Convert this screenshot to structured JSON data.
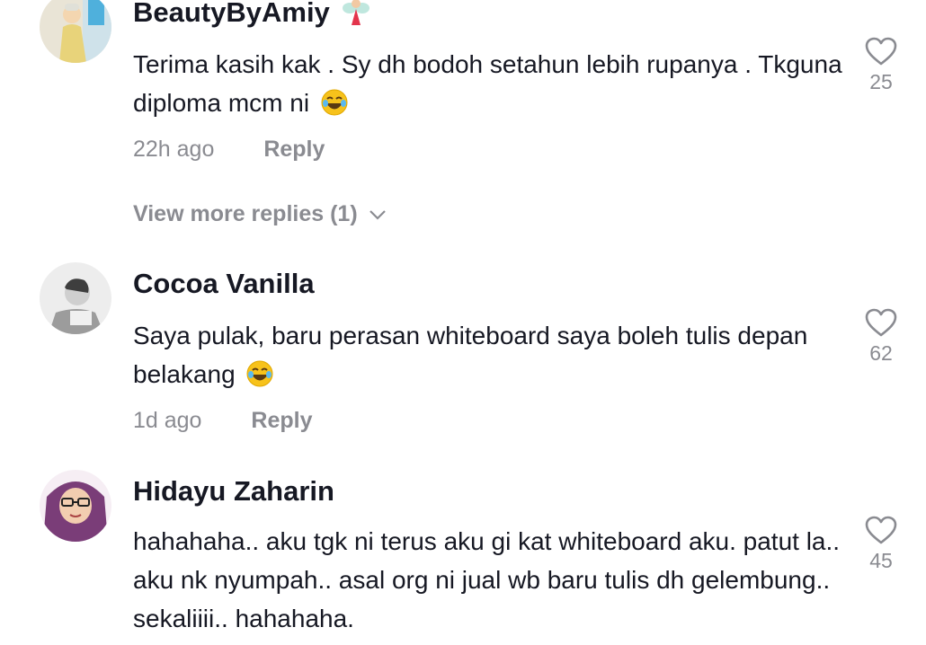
{
  "comments": [
    {
      "username": "BeautyByAmiy",
      "badge_icon": "fairy-emoji-icon",
      "text": "Terima kasih kak . Sy dh bodoh setahun lebih rupanya . Tkguna diploma mcm ni",
      "emoji": "laughing-emoji-icon",
      "time": "22h ago",
      "reply_label": "Reply",
      "likes": "25",
      "view_more": "View more replies (1)"
    },
    {
      "username": "Cocoa Vanilla",
      "text": "Saya pulak, baru perasan whiteboard saya boleh tulis depan belakang",
      "emoji": "laughing-emoji-icon",
      "time": "1d ago",
      "reply_label": "Reply",
      "likes": "62"
    },
    {
      "username": "Hidayu Zaharin",
      "text": "hahahaha.. aku tgk ni terus aku gi kat whiteboard aku. patut la.. aku nk nyumpah.. asal org ni jual wb baru tulis dh gelembung.. sekaliiii.. hahahaha.",
      "likes": "45"
    }
  ],
  "colors": {
    "text": "#161823",
    "secondary": "#8a8b91",
    "emoji": "#f7c21b"
  }
}
